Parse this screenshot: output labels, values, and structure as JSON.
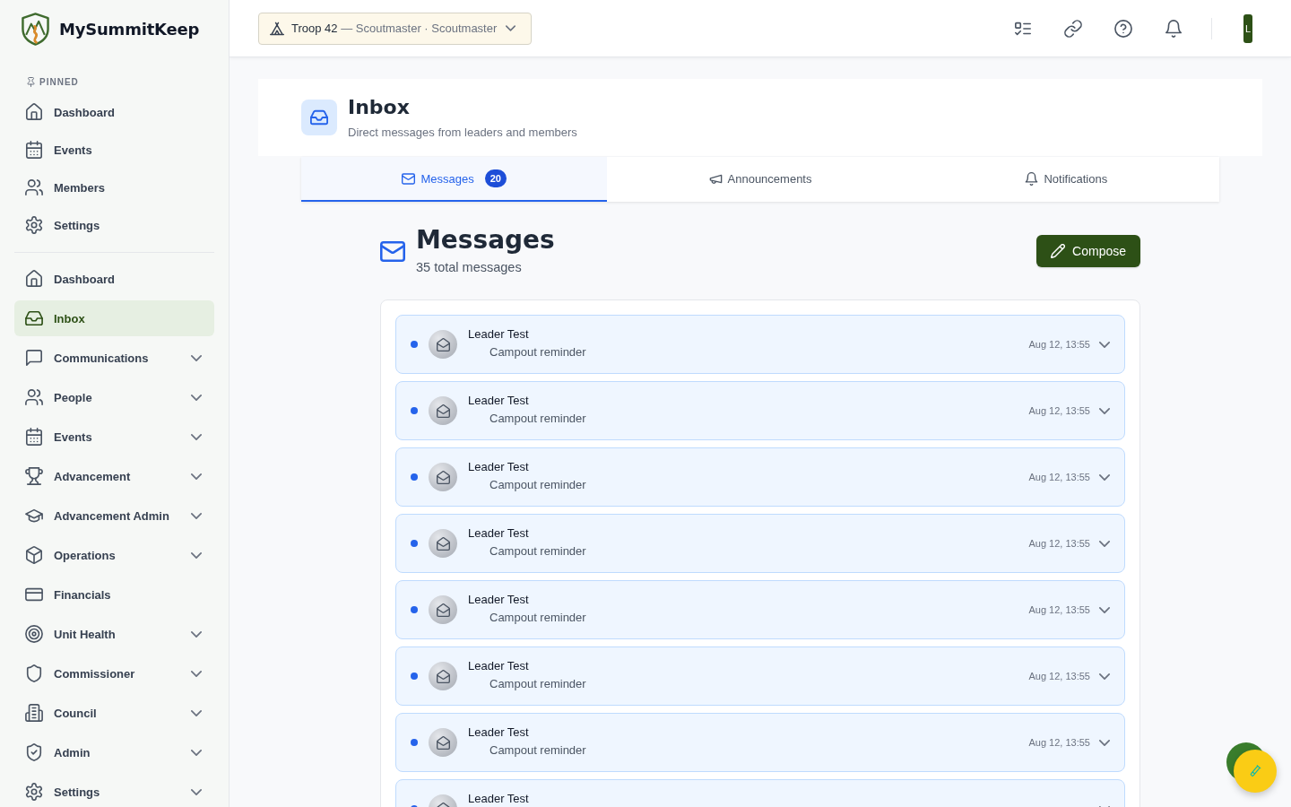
{
  "brand": {
    "name": "MySummitKeep"
  },
  "sidebar": {
    "pinned_label": "PINNED",
    "pinned": [
      {
        "label": "Dashboard",
        "selected": false
      },
      {
        "label": "Events",
        "selected": false
      },
      {
        "label": "Members",
        "selected": false
      },
      {
        "label": "Settings",
        "selected": false
      }
    ],
    "nav": [
      {
        "label": "Dashboard",
        "kind": "link",
        "selected": false
      },
      {
        "label": "Inbox",
        "kind": "link",
        "selected": true
      },
      {
        "label": "Communications",
        "kind": "group",
        "expanded": false,
        "selected": false
      },
      {
        "label": "People",
        "kind": "group",
        "expanded": false,
        "selected": false
      },
      {
        "label": "Events",
        "kind": "group",
        "expanded": false,
        "selected": false
      },
      {
        "label": "Advancement",
        "kind": "group",
        "expanded": false,
        "selected": false
      },
      {
        "label": "Advancement Admin",
        "kind": "group",
        "expanded": false,
        "selected": false
      },
      {
        "label": "Operations",
        "kind": "group",
        "expanded": false,
        "selected": false
      },
      {
        "label": "Financials",
        "kind": "link",
        "selected": false
      },
      {
        "label": "Unit Health",
        "kind": "group",
        "expanded": false,
        "selected": false
      },
      {
        "label": "Commissioner",
        "kind": "group",
        "expanded": false,
        "selected": false
      },
      {
        "label": "Council",
        "kind": "group",
        "expanded": false,
        "selected": false
      },
      {
        "label": "Admin",
        "kind": "group",
        "expanded": false,
        "selected": false
      },
      {
        "label": "Settings",
        "kind": "group",
        "expanded": false,
        "selected": false
      }
    ]
  },
  "topbar": {
    "unit_selector": "**Troop 42** — Scoutmaster · Scoutmaster",
    "avatar_initial": "L"
  },
  "page_header": {
    "title": "Inbox",
    "subtitle": "Direct messages from leaders and members"
  },
  "tabs": [
    {
      "label": "Messages",
      "selected": true,
      "badge": "20"
    },
    {
      "label": "Announcements",
      "selected": false
    },
    {
      "label": "Notifications",
      "selected": false
    }
  ],
  "messages": {
    "title": "Messages",
    "count": "35 total messages",
    "compose_label": "Compose",
    "items": [
      {
        "sender": "Leader Test",
        "subject": "Campout reminder",
        "time": "Aug 12, 13:55",
        "unread": true
      },
      {
        "sender": "Leader Test",
        "subject": "Campout reminder",
        "time": "Aug 12, 13:55",
        "unread": true
      },
      {
        "sender": "Leader Test",
        "subject": "Campout reminder",
        "time": "Aug 12, 13:55",
        "unread": true
      },
      {
        "sender": "Leader Test",
        "subject": "Campout reminder",
        "time": "Aug 12, 13:55",
        "unread": true
      },
      {
        "sender": "Leader Test",
        "subject": "Campout reminder",
        "time": "Aug 12, 13:55",
        "unread": true
      },
      {
        "sender": "Leader Test",
        "subject": "Campout reminder",
        "time": "Aug 12, 13:55",
        "unread": true
      },
      {
        "sender": "Leader Test",
        "subject": "Campout reminder",
        "time": "Aug 12, 13:55",
        "unread": true
      },
      {
        "sender": "Leader Test",
        "unread": true
      }
    ]
  }
}
